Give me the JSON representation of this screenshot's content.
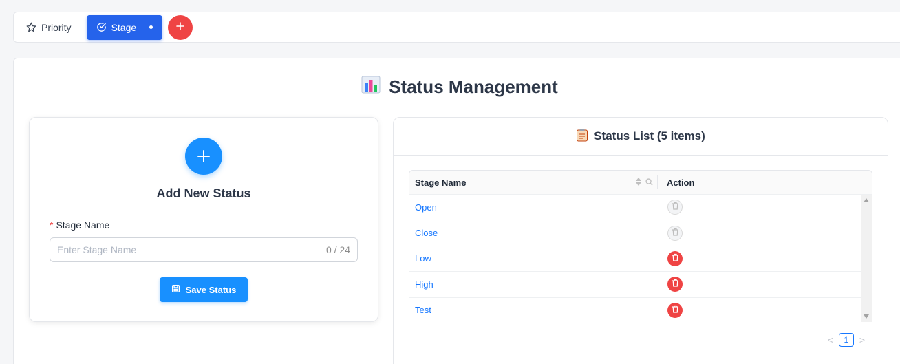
{
  "tabs": [
    {
      "label": "Priority",
      "icon": "star-icon",
      "active": false
    },
    {
      "label": "Stage",
      "icon": "check-circle-icon",
      "active": true
    }
  ],
  "colors": {
    "primary": "#2563eb",
    "accent_blue": "#1890ff",
    "danger": "#ef4444",
    "link": "#1677ff"
  },
  "page": {
    "title": "Status Management",
    "title_icon": "bar-chart-icon"
  },
  "add_form": {
    "heading": "Add New Status",
    "field_label": "Stage Name",
    "required_mark": "*",
    "input_placeholder": "Enter Stage Name",
    "input_value": "",
    "char_count": "0 / 24",
    "save_label": "Save Status"
  },
  "status_list": {
    "title": "Status List (5 items)",
    "title_icon": "clipboard-icon",
    "columns": [
      "Stage Name",
      "Action"
    ],
    "rows": [
      {
        "name": "Open",
        "deletable": false
      },
      {
        "name": "Close",
        "deletable": false
      },
      {
        "name": "Low",
        "deletable": true
      },
      {
        "name": "High",
        "deletable": true
      },
      {
        "name": "Test",
        "deletable": true
      }
    ],
    "pagination": {
      "prev": "<",
      "current": "1",
      "next": ">"
    }
  }
}
